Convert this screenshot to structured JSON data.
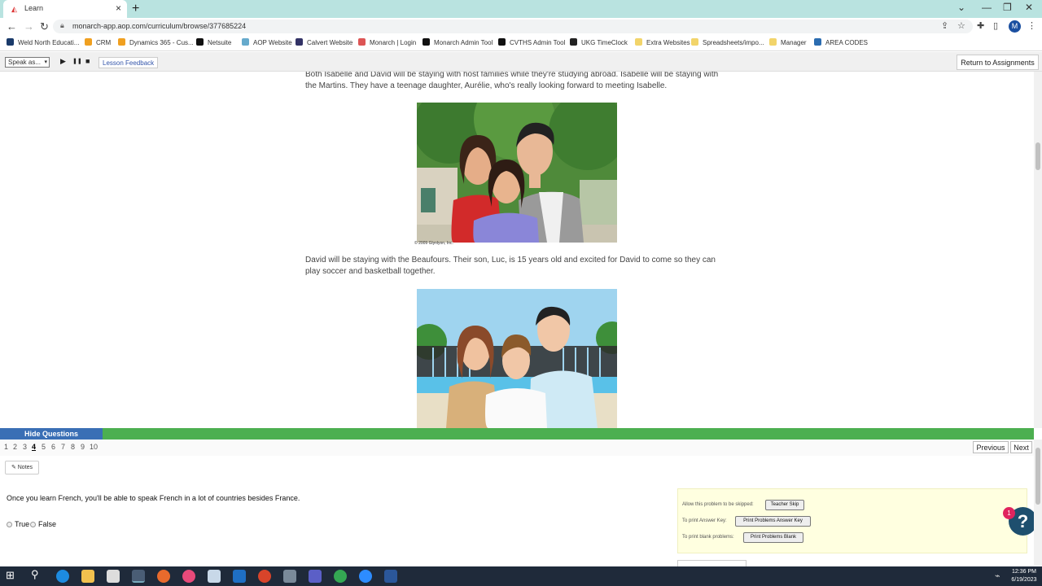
{
  "browser": {
    "tab_title": "Learn",
    "new_tab": "+",
    "url": "monarch-app.aop.com/curriculum/browse/377685224",
    "profile_initial": "M",
    "bookmarks": [
      {
        "label": "Weld North Educati...",
        "color": "#1a3a6a"
      },
      {
        "label": "CRM",
        "color": "#f0a020"
      },
      {
        "label": "Dynamics 365 - Cus...",
        "color": "#f0a020"
      },
      {
        "label": "Netsuite",
        "color": "#111"
      },
      {
        "label": "AOP Website",
        "color": "#6ac"
      },
      {
        "label": "Calvert Website",
        "color": "#336"
      },
      {
        "label": "Monarch | Login",
        "color": "#d55"
      },
      {
        "label": "Monarch Admin Tool",
        "color": "#111"
      },
      {
        "label": "CVTHS Admin Tool",
        "color": "#111"
      },
      {
        "label": "UKG TimeClock",
        "color": "#222"
      },
      {
        "label": "Extra Websites",
        "color": "#f2d46a"
      },
      {
        "label": "Spreadsheets/impo...",
        "color": "#f2d46a"
      },
      {
        "label": "Manager",
        "color": "#f2d46a"
      },
      {
        "label": "AREA CODES",
        "color": "#2b6cb0"
      }
    ]
  },
  "toolbar": {
    "speak_select": "Speak as...",
    "play": "▶",
    "pause": "❚❚",
    "stop": "■",
    "feedback": "Lesson Feedback",
    "return": "Return to Assignments"
  },
  "lesson": {
    "para1": "Both Isabelle and David will be staying with host families while they're studying abroad. Isabelle will be staying with the Martins. They have a teenage daughter, Aurélie, who's really looking forward to meeting Isabelle.",
    "credit": "© 2009 Glynlyon, Inc.",
    "para2": "David will be staying with the Beaufours. Their son, Luc, is 15 years old and excited for David to come so they can play soccer and basketball together."
  },
  "questions": {
    "hide_label": "Hide Questions",
    "numbers": [
      "1",
      "2",
      "3",
      "4",
      "5",
      "6",
      "7",
      "8",
      "9",
      "10"
    ],
    "current": "4",
    "previous": "Previous",
    "next": "Next",
    "notes": "✎ Notes",
    "question_text": "Once you learn French, you'll be able to speak French in a lot of countries besides France.",
    "options": [
      "True",
      "False"
    ],
    "teacher": {
      "skip_label": "Allow this problem to be skipped:",
      "skip_btn": "Teacher Skip",
      "key_label": "To print Answer Key:",
      "key_btn": "Print Problems Answer Key",
      "blank_label": "To print blank problems:",
      "blank_btn": "Print Problems Blank"
    },
    "help": "?",
    "help_badge": "1"
  },
  "taskbar": {
    "time": "12:36 PM",
    "date": "6/19/2023"
  }
}
